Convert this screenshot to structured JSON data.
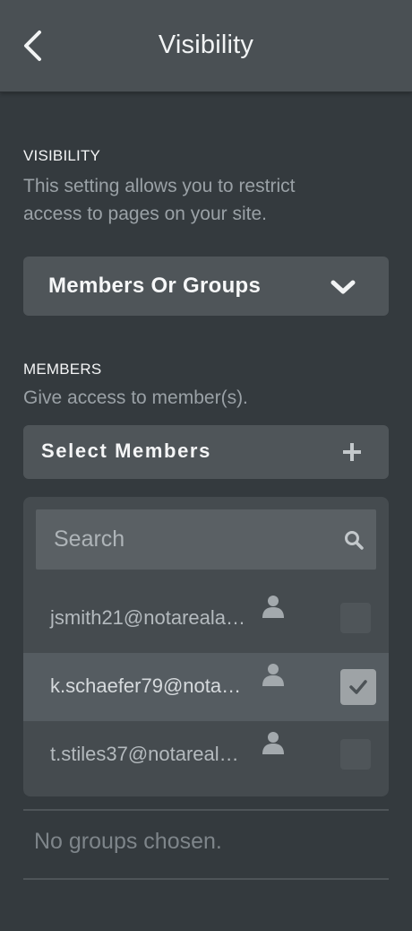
{
  "header": {
    "title": "Visibility",
    "back_icon": "chevron-left-icon"
  },
  "visibility": {
    "label": "VISIBILITY",
    "description_line1": "This setting allows you to restrict",
    "description_line2": "access to pages on your site.",
    "dropdown_value": "Members Or Groups",
    "dropdown_icon": "chevron-down-icon"
  },
  "members": {
    "label": "MEMBERS",
    "description": "Give access to member(s).",
    "select_label": "Select Members",
    "add_icon": "plus-icon",
    "search_placeholder": "Search",
    "list": [
      {
        "email": "jsmith21@notareala…",
        "checked": false
      },
      {
        "email": "k.schaefer79@nota…",
        "checked": true
      },
      {
        "email": "t.stiles37@notareal…",
        "checked": false
      }
    ]
  },
  "groups": {
    "empty_text": "No groups chosen."
  },
  "colors": {
    "background": "#343a3e",
    "header": "#4a5054",
    "control": "#4f5559",
    "selected_row": "#555c61"
  }
}
